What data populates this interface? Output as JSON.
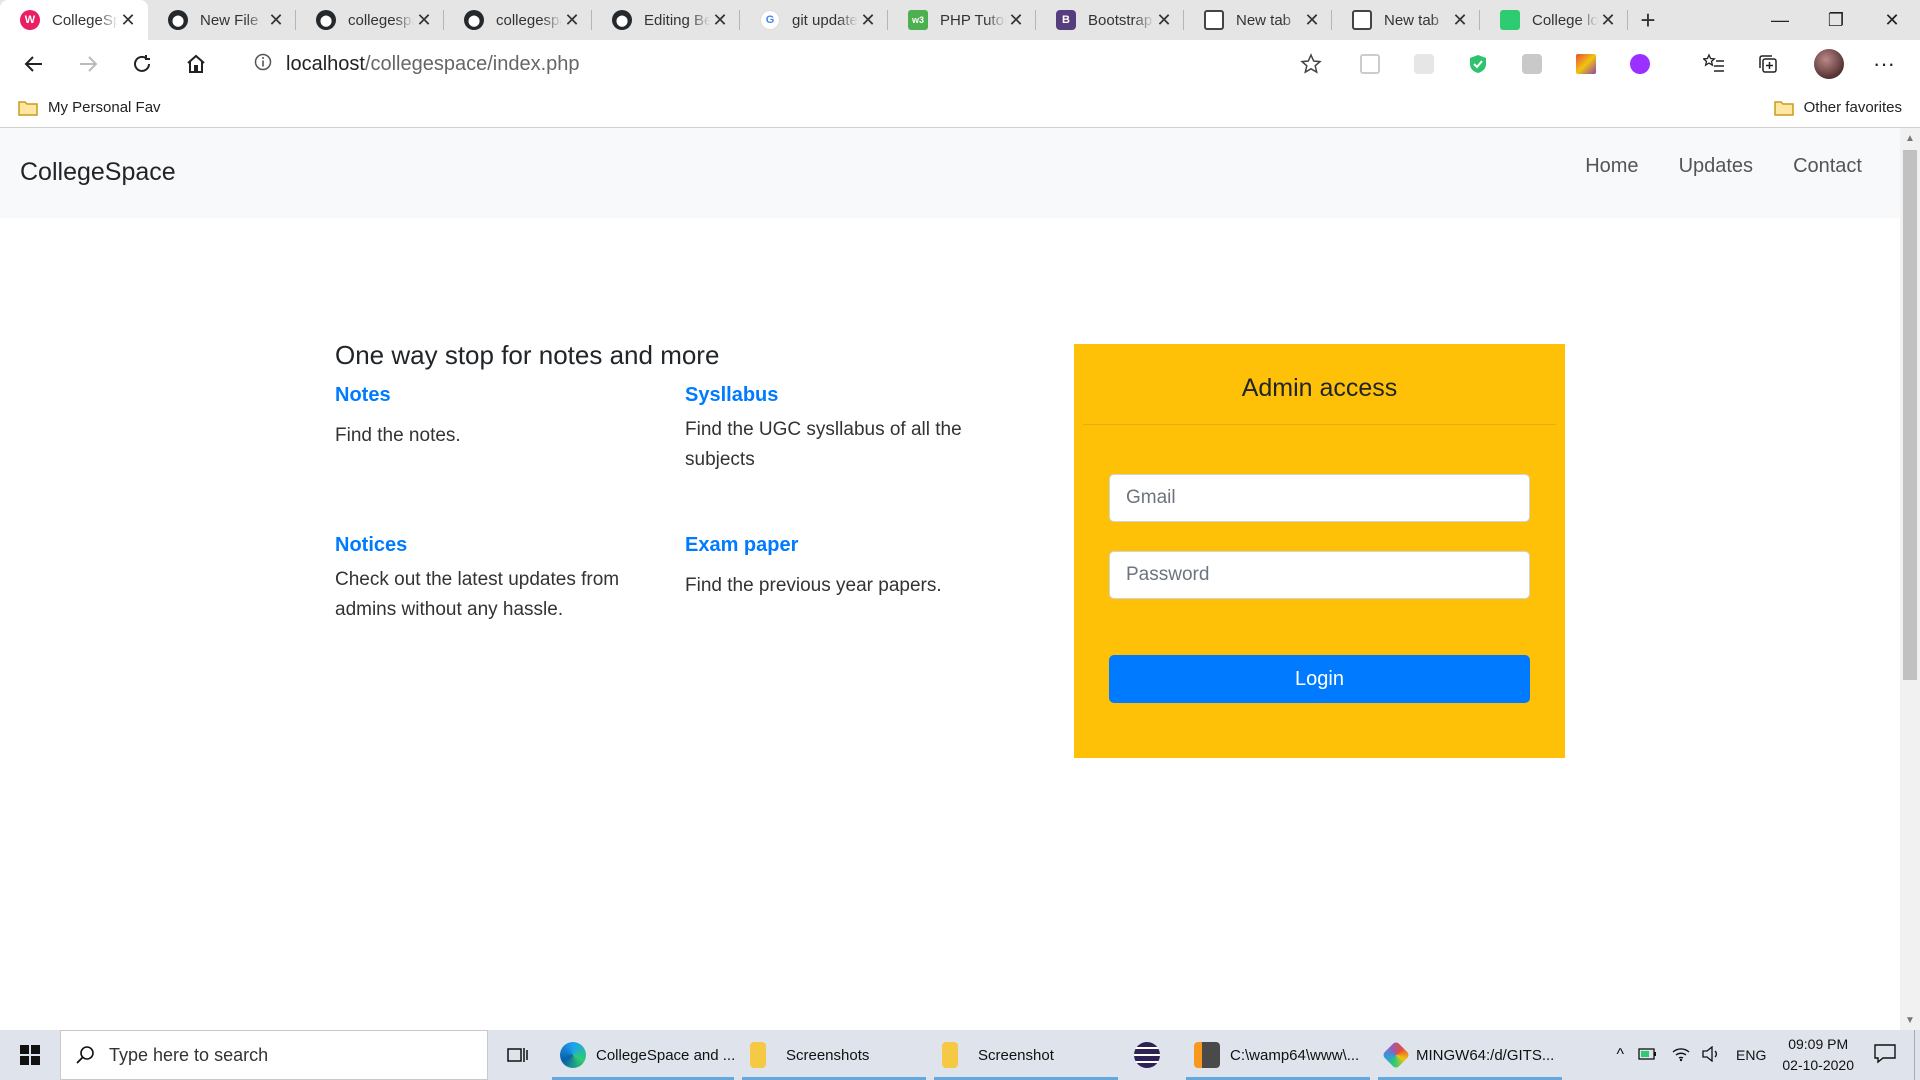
{
  "browser": {
    "tabs": [
      {
        "title": "CollegeSpace",
        "favicon": "w-icon",
        "color": "#e91e63",
        "active": true
      },
      {
        "title": "New File",
        "favicon": "github-icon",
        "color": "#24292e"
      },
      {
        "title": "collegespace",
        "favicon": "github-icon",
        "color": "#24292e"
      },
      {
        "title": "collegespace",
        "favicon": "github-icon",
        "color": "#24292e"
      },
      {
        "title": "Editing Be",
        "favicon": "github-icon",
        "color": "#24292e"
      },
      {
        "title": "git update",
        "favicon": "google-icon",
        "color": "#4285f4"
      },
      {
        "title": "PHP Tutor",
        "favicon": "w3schools-icon",
        "color": "#4caf50"
      },
      {
        "title": "Bootstrap",
        "favicon": "bootstrap-icon",
        "color": "#563d7c"
      },
      {
        "title": "New tab",
        "favicon": "newtab-icon",
        "color": "#444"
      },
      {
        "title": "New tab",
        "favicon": "newtab-icon",
        "color": "#444"
      },
      {
        "title": "College lo",
        "favicon": "green-doc-icon",
        "color": "#2ecc71"
      }
    ],
    "address": {
      "host": "localhost",
      "path": "/collegespace/index.php"
    },
    "bookmarks": {
      "left": "My Personal Fav",
      "right": "Other favorites"
    }
  },
  "site": {
    "brand": "CollegeSpace",
    "nav": [
      "Home",
      "Updates",
      "Contact"
    ],
    "intro": "One way stop for notes and more",
    "features": [
      {
        "title": "Notes",
        "text": "Find the notes."
      },
      {
        "title": "Sysllabus",
        "text": "Find the UGC sysllabus of all the subjects"
      },
      {
        "title": "Notices",
        "text": "Check out the latest updates from admins without any hassle."
      },
      {
        "title": "Exam paper",
        "text": "Find the previous year papers."
      }
    ],
    "admin": {
      "title": "Admin access",
      "email_placeholder": "Gmail",
      "password_placeholder": "Password",
      "login_label": "Login"
    }
  },
  "taskbar": {
    "search_placeholder": "Type here to search",
    "apps": [
      {
        "label": "CollegeSpace and ...",
        "icon": "edge-icon"
      },
      {
        "label": "Screenshots",
        "icon": "folder-icon"
      },
      {
        "label": "Screenshot",
        "icon": "folder-icon"
      },
      {
        "label": "",
        "icon": "eclipse-icon"
      },
      {
        "label": "C:\\wamp64\\www\\...",
        "icon": "sublime-icon"
      },
      {
        "label": "MINGW64:/d/GITS...",
        "icon": "git-icon"
      }
    ],
    "lang": "ENG",
    "time": "09:09 PM",
    "date": "02-10-2020"
  }
}
